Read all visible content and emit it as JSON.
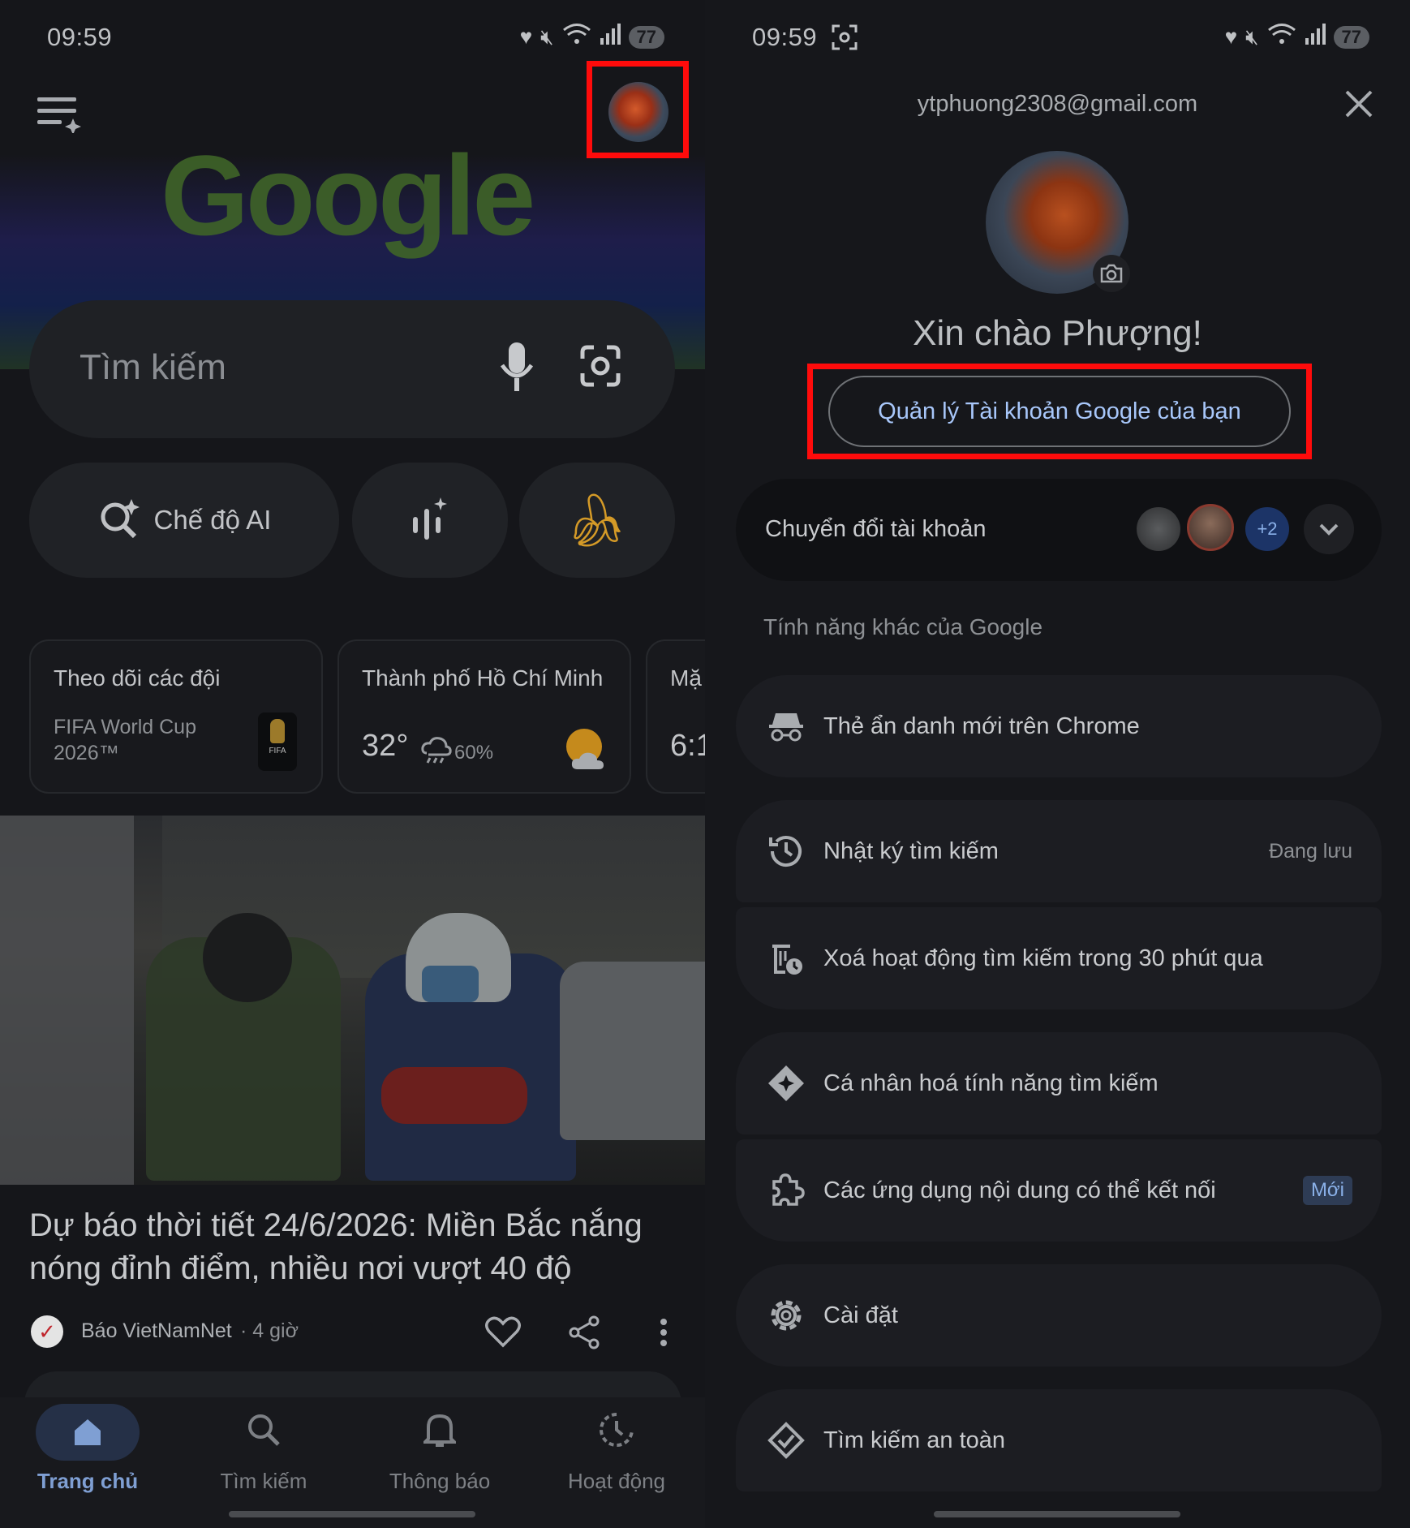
{
  "left": {
    "status": {
      "time": "09:59",
      "battery": "77"
    },
    "logo_text": "Google",
    "search": {
      "placeholder": "Tìm kiếm"
    },
    "chips": {
      "ai_mode": "Chế độ AI"
    },
    "cards": [
      {
        "title": "Theo dõi các đội",
        "subtitle_line1": "FIFA World Cup",
        "subtitle_line2": "2026™",
        "badge": "FIFA"
      },
      {
        "title": "Thành phố Hồ Chí Minh",
        "temperature": "32°",
        "rain": "60%"
      },
      {
        "title": "Mặ",
        "value": "6:1"
      }
    ],
    "news": {
      "headline": "Dự báo thời tiết 24/6/2026: Miền Bắc nắng nóng đỉnh điểm, nhiều nơi vượt 40 độ",
      "source": "Báo VietNamNet",
      "time": "· 4 giờ"
    },
    "nav": [
      {
        "label": "Trang chủ",
        "icon": "home-icon"
      },
      {
        "label": "Tìm kiếm",
        "icon": "search-icon"
      },
      {
        "label": "Thông báo",
        "icon": "bell-icon"
      },
      {
        "label": "Hoạt động",
        "icon": "activity-icon"
      }
    ]
  },
  "right": {
    "status": {
      "time": "09:59",
      "battery": "77"
    },
    "email": "ytphuong2308@gmail.com",
    "greeting": "Xin chào Phượng!",
    "manage_button": "Quản lý Tài khoản Google của bạn",
    "switch_account": {
      "label": "Chuyển đổi tài khoản",
      "extra_count": "+2"
    },
    "section_title": "Tính năng khác của Google",
    "menu": {
      "incognito": "Thẻ ẩn danh mới trên Chrome",
      "history": "Nhật ký tìm kiếm",
      "history_status": "Đang lưu",
      "delete_recent": "Xoá hoạt động tìm kiếm trong 30 phút qua",
      "personalize": "Cá nhân hoá tính năng tìm kiếm",
      "connected_apps": "Các ứng dụng nội dung có thể kết nối",
      "new_badge": "Mới",
      "settings": "Cài đặt",
      "safe_search": "Tìm kiếm an toàn"
    }
  },
  "colors": {
    "highlight": "#ff0b0b",
    "accent_blue": "#a8c7fa",
    "google_green": "#4f7a2d"
  }
}
